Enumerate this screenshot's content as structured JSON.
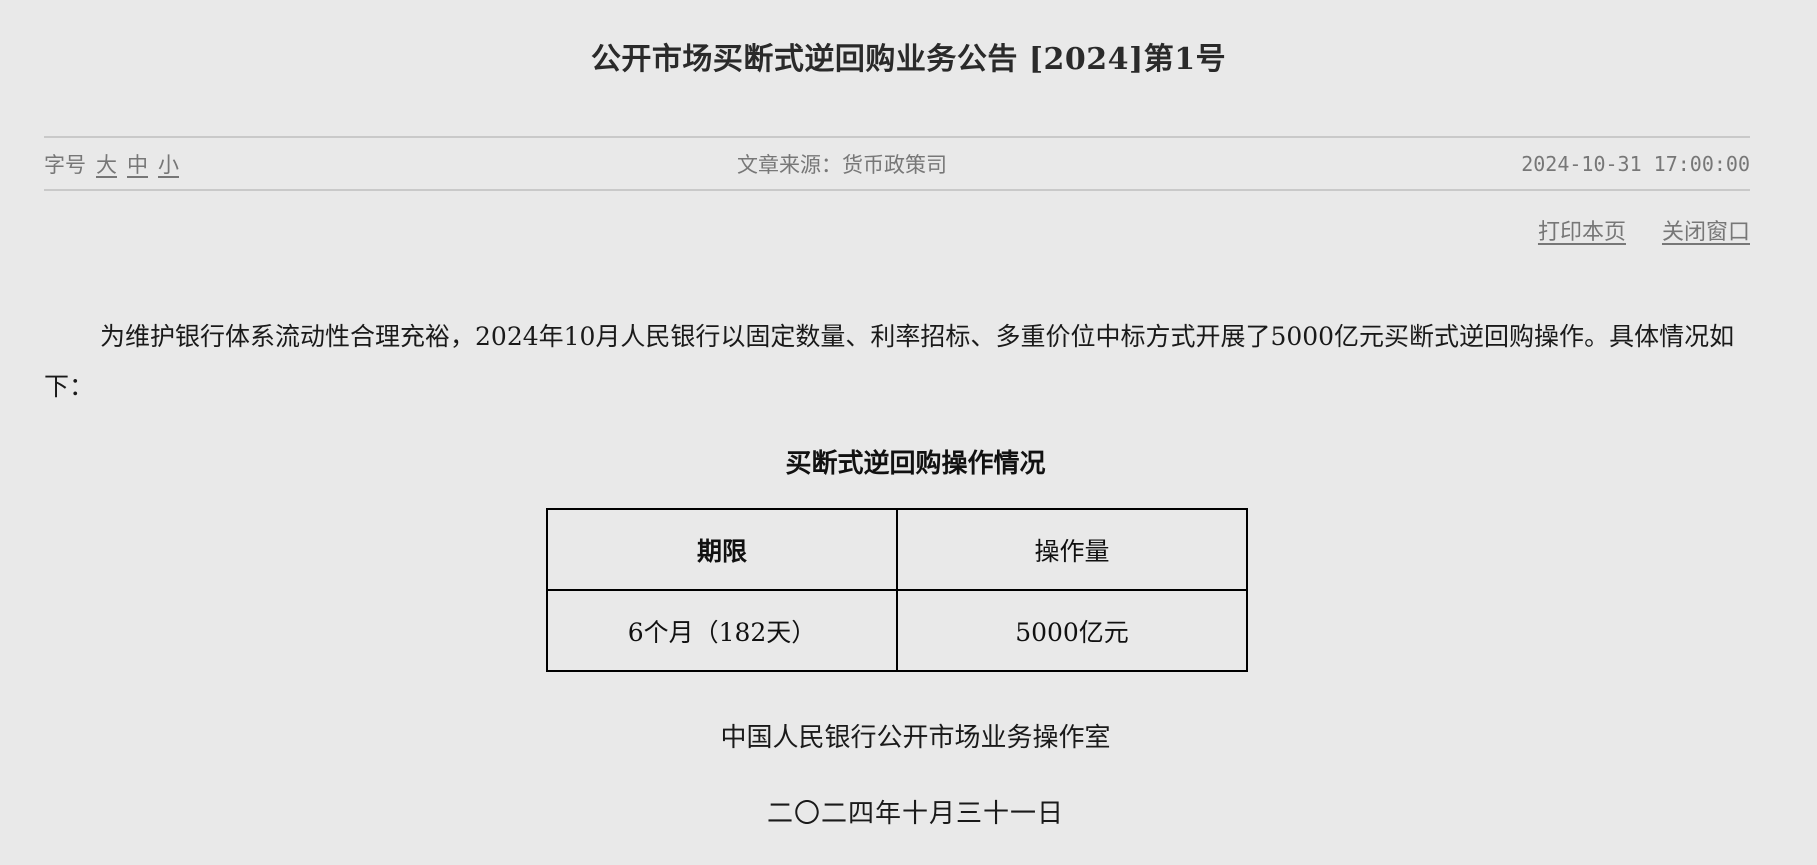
{
  "title": "公开市场买断式逆回购业务公告 [2024]第1号",
  "meta": {
    "font_size_label": "字号",
    "font_sizes": [
      "大",
      "中",
      "小"
    ],
    "source": "文章来源：货币政策司",
    "datetime": "2024-10-31 17:00:00"
  },
  "actions": {
    "print": "打印本页",
    "close": "关闭窗口"
  },
  "body": {
    "paragraph": "为维护银行体系流动性合理充裕，2024年10月人民银行以固定数量、利率招标、多重价位中标方式开展了5000亿元买断式逆回购操作。具体情况如下："
  },
  "table": {
    "caption": "买断式逆回购操作情况",
    "headers": [
      "期限",
      "操作量"
    ],
    "rows": [
      [
        "6个月（182天）",
        "5000亿元"
      ]
    ]
  },
  "signature": {
    "org": "中国人民银行公开市场业务操作室",
    "date": "二〇二四年十月三十一日"
  }
}
